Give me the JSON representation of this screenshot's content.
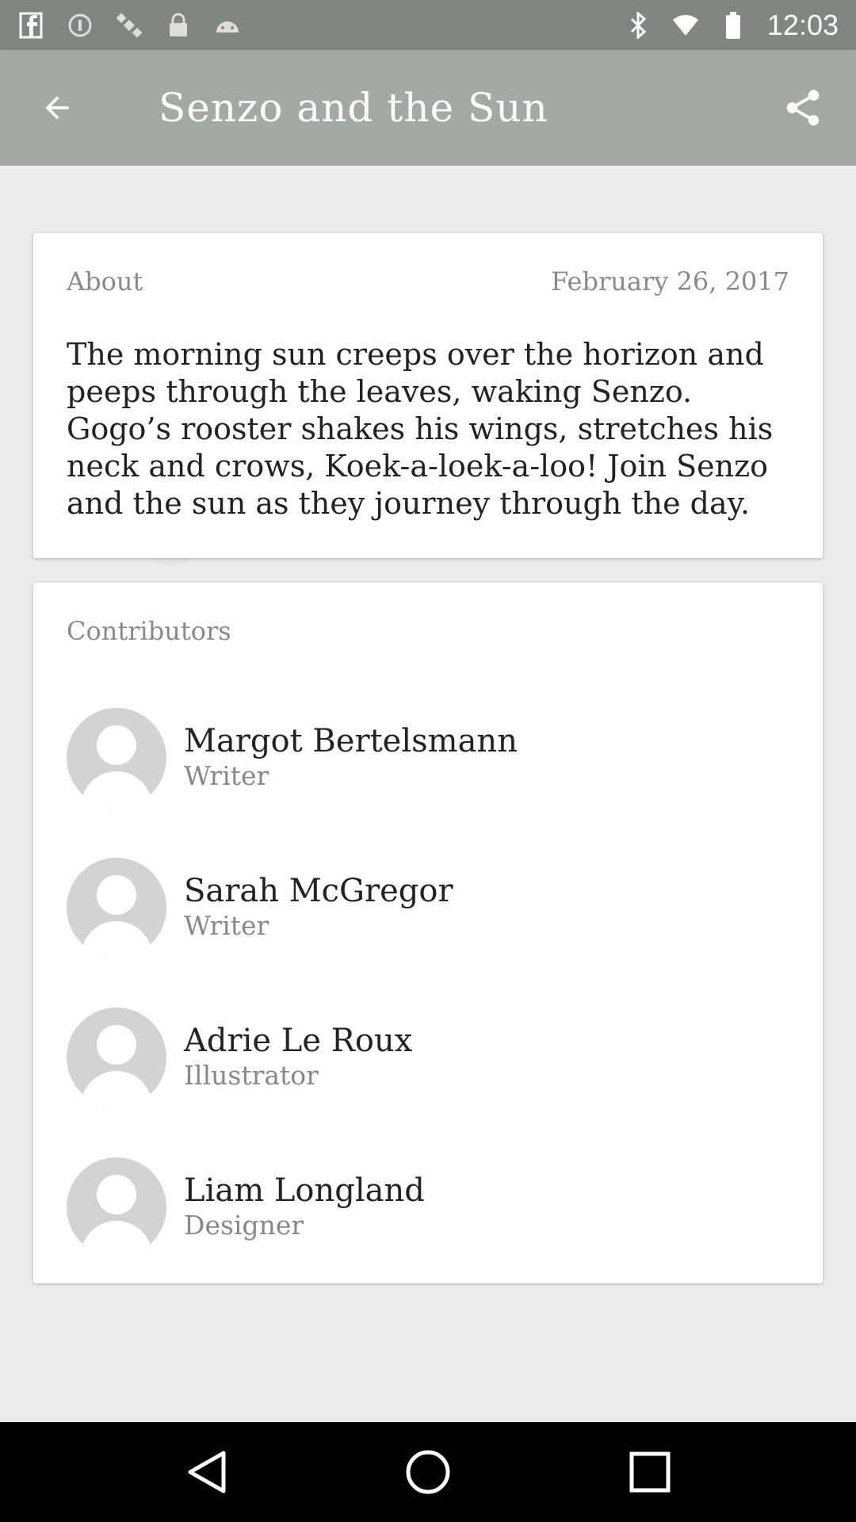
{
  "status_bar": {
    "time": "12:03",
    "left_icons": [
      "facebook-icon",
      "info-icon",
      "satellite-icon",
      "lock-icon",
      "android-icon"
    ],
    "right_icons": [
      "bluetooth-icon",
      "wifi-icon",
      "battery-icon"
    ]
  },
  "app_bar": {
    "title": "Senzo and the Sun"
  },
  "about": {
    "label": "About",
    "date": "February 26, 2017",
    "text": "The morning sun creeps over the horizon and peeps through the leaves, waking Senzo. Gogo’s rooster shakes his wings, stretches his neck and crows, Koek-a-loek-a-loo! Join Senzo and the sun as they journey through the day."
  },
  "contributors": {
    "title": "Contributors",
    "items": [
      {
        "name": "Margot Bertelsmann",
        "role": "Writer"
      },
      {
        "name": "Sarah McGregor",
        "role": "Writer"
      },
      {
        "name": "Adrie Le Roux",
        "role": "Illustrator"
      },
      {
        "name": "Liam Longland",
        "role": "Designer"
      }
    ]
  },
  "colors": {
    "status_bar": "#7f8780",
    "app_bar": "#a3aaa3",
    "background": "#ececea",
    "card": "#ffffff"
  }
}
